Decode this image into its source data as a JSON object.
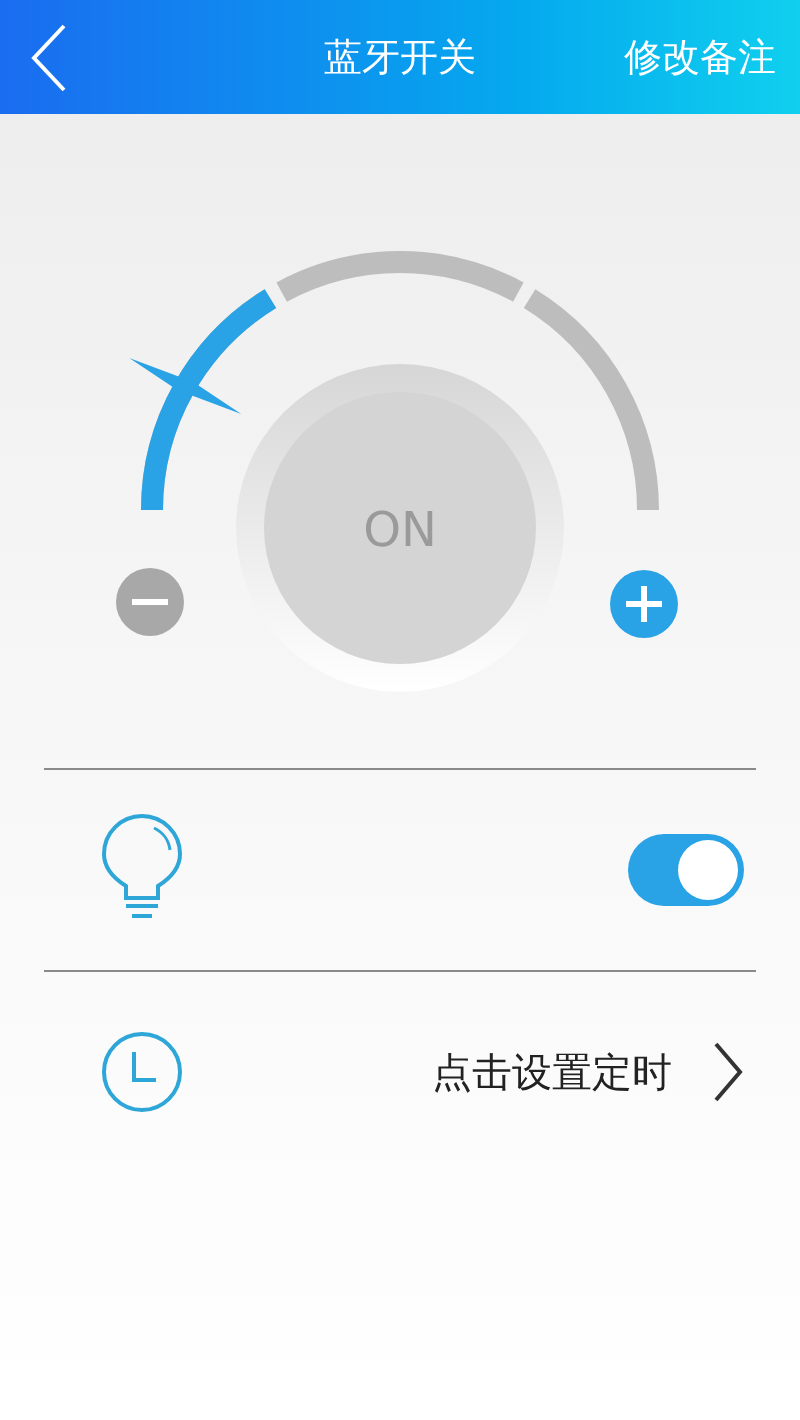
{
  "header": {
    "title": "蓝牙开关",
    "action": "修改备注"
  },
  "dial": {
    "label": "ON"
  },
  "light": {
    "on": true
  },
  "timer": {
    "label": "点击设置定时"
  }
}
